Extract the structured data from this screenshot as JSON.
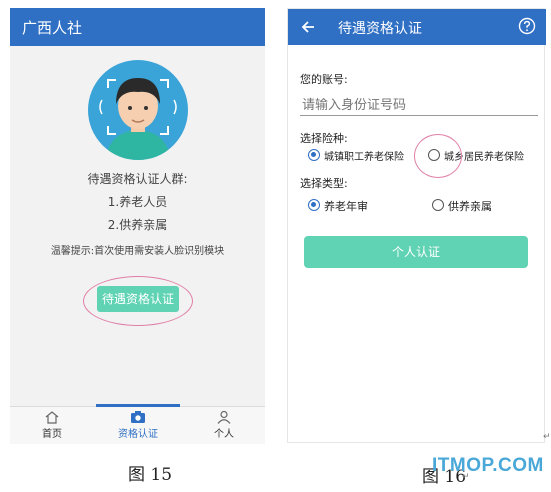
{
  "phone1": {
    "app_title": "广西人社",
    "intro": "待遇资格认证人群:",
    "items": [
      "1.养老人员",
      "2.供养亲属"
    ],
    "hint": "温馨提示:首次使用需安装人脸识别模块",
    "auth_button": "待遇资格认证",
    "tabs": [
      {
        "label": "首页",
        "icon": "home-icon"
      },
      {
        "label": "资格认证",
        "icon": "camera-icon",
        "active": true
      },
      {
        "label": "个人",
        "icon": "person-icon"
      }
    ]
  },
  "phone2": {
    "title": "待遇资格认证",
    "account_label": "您的账号:",
    "account_placeholder": "请输入身份证号码",
    "insurance_label": "选择险种:",
    "insurance_options": [
      "城镇职工养老保险",
      "城乡居民养老保险"
    ],
    "insurance_selected": 0,
    "type_label": "选择类型:",
    "type_options": [
      "养老年审",
      "供养亲属"
    ],
    "type_selected": 0,
    "submit_button": "个人认证"
  },
  "captions": {
    "left": "图 15",
    "right": "图 16",
    "return_mark_1": "↵",
    "return_mark_2": "↵"
  },
  "watermark": "ITMOP.COM",
  "colors": {
    "header": "#2f6fc4",
    "button": "#5fd3b3",
    "annotation": "#e07fa6"
  }
}
